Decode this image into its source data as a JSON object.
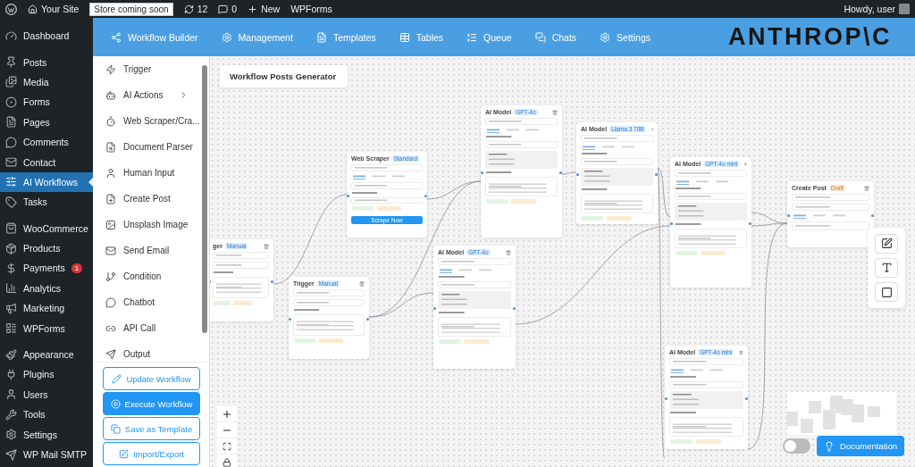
{
  "admin_bar": {
    "site": "Your Site",
    "store_badge": "Store coming soon",
    "updates": "12",
    "comments": "0",
    "new": "New",
    "wpforms": "WPForms",
    "greeting": "Howdy, user"
  },
  "sidebar": {
    "groups": [
      [
        {
          "label": "Dashboard",
          "selected": false
        }
      ],
      [
        {
          "label": "Posts",
          "selected": false
        },
        {
          "label": "Media",
          "selected": false
        },
        {
          "label": "Forms",
          "selected": false
        },
        {
          "label": "Pages",
          "selected": false
        },
        {
          "label": "Comments",
          "selected": false
        },
        {
          "label": "Contact",
          "selected": false
        },
        {
          "label": "AI Workflows",
          "selected": true
        },
        {
          "label": "Tasks",
          "selected": false
        }
      ],
      [
        {
          "label": "WooCommerce",
          "selected": false
        },
        {
          "label": "Products",
          "selected": false
        },
        {
          "label": "Payments",
          "selected": false,
          "badge": "1"
        },
        {
          "label": "Analytics",
          "selected": false
        },
        {
          "label": "Marketing",
          "selected": false
        },
        {
          "label": "WPForms",
          "selected": false
        }
      ],
      [
        {
          "label": "Appearance",
          "selected": false
        },
        {
          "label": "Plugins",
          "selected": false
        },
        {
          "label": "Users",
          "selected": false
        },
        {
          "label": "Tools",
          "selected": false
        },
        {
          "label": "Settings",
          "selected": false
        },
        {
          "label": "WP Mail SMTP",
          "selected": false
        }
      ]
    ]
  },
  "nav": {
    "items": [
      "Workflow Builder",
      "Management",
      "Templates",
      "Tables",
      "Queue",
      "Chats",
      "Settings"
    ],
    "logo": "ANTHROP\\C"
  },
  "palette": {
    "items": [
      {
        "label": "Trigger",
        "submenu": false
      },
      {
        "label": "AI Actions",
        "submenu": true
      },
      {
        "label": "Web Scraper/Cra...",
        "submenu": false
      },
      {
        "label": "Document Parser",
        "submenu": false
      },
      {
        "label": "Human Input",
        "submenu": false
      },
      {
        "label": "Create Post",
        "submenu": false
      },
      {
        "label": "Unsplash Image",
        "submenu": false
      },
      {
        "label": "Send Email",
        "submenu": false
      },
      {
        "label": "Condition",
        "submenu": false
      },
      {
        "label": "Chatbot",
        "submenu": false
      },
      {
        "label": "API Call",
        "submenu": false
      },
      {
        "label": "Output",
        "submenu": false
      }
    ],
    "buttons": [
      {
        "label": "Update Workflow",
        "primary": false
      },
      {
        "label": "Execute Workflow",
        "primary": true
      },
      {
        "label": "Save as Template",
        "primary": false
      },
      {
        "label": "Import/Export",
        "primary": false
      }
    ]
  },
  "canvas": {
    "title": "Workflow Posts Generator",
    "nodes": [
      {
        "kind": "trigger",
        "title": "ger",
        "badge": "Manual"
      },
      {
        "kind": "scraper",
        "title": "Web Scraper",
        "badge": "Standard",
        "action": "Scrape Now"
      },
      {
        "kind": "trigger",
        "title": "Trigger",
        "badge": "Manual"
      },
      {
        "kind": "ai",
        "title": "AI Model",
        "badge": "GPT-4o"
      },
      {
        "kind": "ai",
        "title": "AI Model",
        "badge": "GPT-4o"
      },
      {
        "kind": "ai",
        "title": "AI Model",
        "badge": "Llama 3 70B"
      },
      {
        "kind": "ai",
        "title": "AI Model",
        "badge": "GPT-4o mini"
      },
      {
        "kind": "post",
        "title": "Create Post",
        "badge": "Draft"
      },
      {
        "kind": "ai",
        "title": "AI Model",
        "badge": "GPT-4o mini"
      }
    ],
    "theme_toggle": {
      "on": false
    },
    "doc_button": "Documentation"
  }
}
